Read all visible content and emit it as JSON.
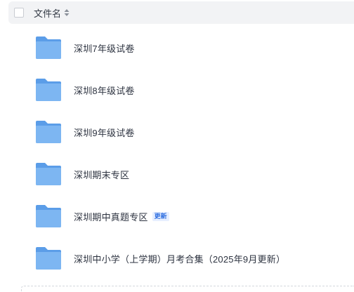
{
  "header": {
    "column_name": "文件名",
    "sort_icon": "sort-icon"
  },
  "files": [
    {
      "name": "深圳7年级试卷",
      "icon": "folder-icon",
      "badge": ""
    },
    {
      "name": "深圳8年级试卷",
      "icon": "folder-icon",
      "badge": ""
    },
    {
      "name": "深圳9年级试卷",
      "icon": "folder-icon",
      "badge": ""
    },
    {
      "name": "深圳期末专区",
      "icon": "folder-icon",
      "badge": ""
    },
    {
      "name": "深圳期中真题专区",
      "icon": "folder-icon",
      "badge": "更新"
    },
    {
      "name": "深圳中小学（上学期）月考合集（2025年9月更新）",
      "icon": "folder-icon",
      "badge": ""
    }
  ],
  "colors": {
    "header_bg": "#f2f3f5",
    "folder_blue": "#6aaaf0",
    "badge_text": "#2f6fe0"
  }
}
